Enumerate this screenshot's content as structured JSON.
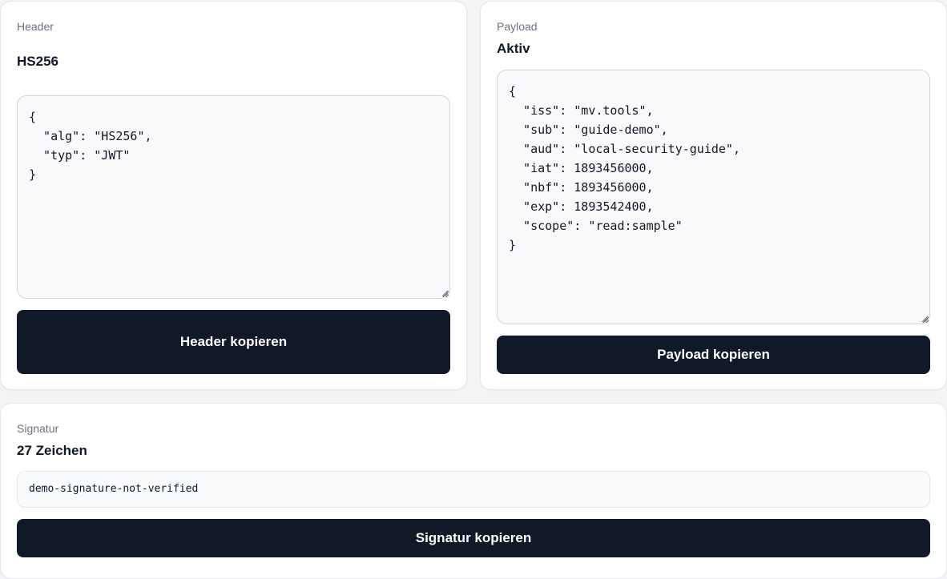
{
  "header": {
    "label": "Header",
    "algorithm": "HS256",
    "json": "{\n  \"alg\": \"HS256\",\n  \"typ\": \"JWT\"\n}",
    "copy_label": "Header kopieren"
  },
  "payload": {
    "label": "Payload",
    "status": "Aktiv",
    "json": "{\n  \"iss\": \"mv.tools\",\n  \"sub\": \"guide-demo\",\n  \"aud\": \"local-security-guide\",\n  \"iat\": 1893456000,\n  \"nbf\": 1893456000,\n  \"exp\": 1893542400,\n  \"scope\": \"read:sample\"\n}",
    "copy_label": "Payload kopieren"
  },
  "signature": {
    "label": "Signatur",
    "length": "27 Zeichen",
    "value": "demo-signature-not-verified",
    "copy_label": "Signatur kopieren"
  },
  "colors": {
    "button_bg": "#111827",
    "card_border": "#e5e7eb",
    "muted_text": "#6b7280"
  }
}
